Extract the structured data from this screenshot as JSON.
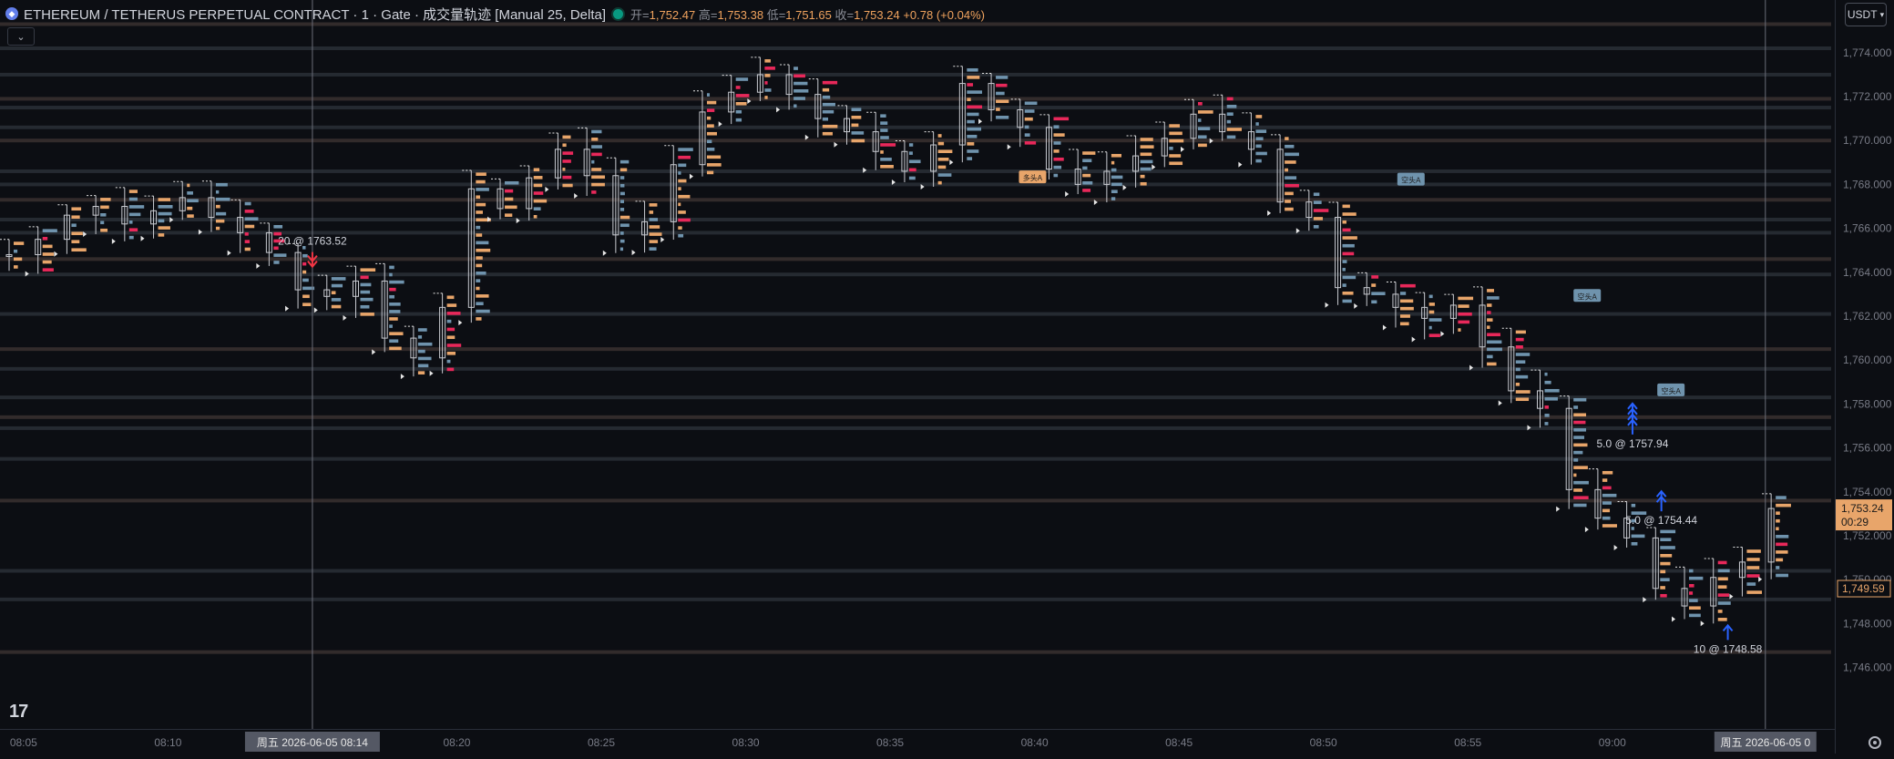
{
  "header": {
    "symbol": "ETHEREUM / TETHERUS PERPETUAL CONTRACT · 1 · Gate · 成交量轨迹 [Manual 25, Delta]",
    "open_label": "开=",
    "open": "1,752.47",
    "high_label": "高=",
    "high": "1,753.38",
    "low_label": "低=",
    "low": "1,751.65",
    "close_label": "收=",
    "close": "1,753.24",
    "change": "+0.78 (+0.04%)"
  },
  "currency_button": "USDT",
  "crosshair": {
    "left_date_label": "周五 2026-06-05   08:14",
    "right_date_label": "周五 2026-06-05   0"
  },
  "price_tags": {
    "last_price": "1,753.24",
    "countdown": "00:29",
    "marker_price": "1,749.59"
  },
  "colors": {
    "background": "#0c0e13",
    "buy_bar": "#e8a56a",
    "sell_bar": "#6f93ad",
    "delta_highlight": "#e8285a",
    "level_line": "#2a2f37",
    "arrow_blue": "#2962ff",
    "arrow_red": "#f23645"
  },
  "chart_data": {
    "type": "line",
    "title": "",
    "xlabel": "",
    "ylabel": "",
    "x_ticks": [
      "08:05",
      "08:10",
      "08:20",
      "08:25",
      "08:30",
      "08:35",
      "08:40",
      "08:45",
      "08:50",
      "08:55",
      "09:00"
    ],
    "y_ticks": [
      1746,
      1748,
      1750,
      1752,
      1754,
      1756,
      1758,
      1760,
      1762,
      1764,
      1766,
      1768,
      1770,
      1772,
      1774
    ],
    "ylim": [
      1743.2,
      1776.4
    ],
    "x_minutes_range": [
      0,
      61.5
    ],
    "series": [
      {
        "values": [
          {
            "t": 0,
            "p": 1764.8
          },
          {
            "t": 1,
            "p": 1765.5
          },
          {
            "t": 2,
            "p": 1766.6
          },
          {
            "t": 3,
            "p": 1767.0
          },
          {
            "t": 4,
            "p": 1766.2
          },
          {
            "t": 5,
            "p": 1766.8
          },
          {
            "t": 6,
            "p": 1767.4
          },
          {
            "t": 7,
            "p": 1766.5
          },
          {
            "t": 8,
            "p": 1765.8
          },
          {
            "t": 9,
            "p": 1764.9
          },
          {
            "t": 10,
            "p": 1763.2
          },
          {
            "t": 11,
            "p": 1762.9
          },
          {
            "t": 12,
            "p": 1763.6
          },
          {
            "t": 13,
            "p": 1761.0
          },
          {
            "t": 14,
            "p": 1760.1
          },
          {
            "t": 15,
            "p": 1762.4
          },
          {
            "t": 16,
            "p": 1767.8
          },
          {
            "t": 17,
            "p": 1766.9
          },
          {
            "t": 18,
            "p": 1768.3
          },
          {
            "t": 19,
            "p": 1769.6
          },
          {
            "t": 20,
            "p": 1768.4
          },
          {
            "t": 21,
            "p": 1765.7
          },
          {
            "t": 22,
            "p": 1766.3
          },
          {
            "t": 23,
            "p": 1768.9
          },
          {
            "t": 24,
            "p": 1771.3
          },
          {
            "t": 25,
            "p": 1772.2
          },
          {
            "t": 26,
            "p": 1773.0
          },
          {
            "t": 27,
            "p": 1772.1
          },
          {
            "t": 28,
            "p": 1771.0
          },
          {
            "t": 29,
            "p": 1770.4
          },
          {
            "t": 30,
            "p": 1769.5
          },
          {
            "t": 31,
            "p": 1768.6
          },
          {
            "t": 32,
            "p": 1769.8
          },
          {
            "t": 33,
            "p": 1772.6
          },
          {
            "t": 34,
            "p": 1771.4
          },
          {
            "t": 35,
            "p": 1770.6
          },
          {
            "t": 36,
            "p": 1768.7
          },
          {
            "t": 37,
            "p": 1768.0
          },
          {
            "t": 38,
            "p": 1768.6
          },
          {
            "t": 39,
            "p": 1769.3
          },
          {
            "t": 40,
            "p": 1770.1
          },
          {
            "t": 41,
            "p": 1771.2
          },
          {
            "t": 42,
            "p": 1770.4
          },
          {
            "t": 43,
            "p": 1769.6
          },
          {
            "t": 44,
            "p": 1767.2
          },
          {
            "t": 45,
            "p": 1766.5
          },
          {
            "t": 46,
            "p": 1763.3
          },
          {
            "t": 47,
            "p": 1763.0
          },
          {
            "t": 48,
            "p": 1762.4
          },
          {
            "t": 49,
            "p": 1761.9
          },
          {
            "t": 50,
            "p": 1762.5
          },
          {
            "t": 51,
            "p": 1760.6
          },
          {
            "t": 52,
            "p": 1758.6
          },
          {
            "t": 53,
            "p": 1757.8
          },
          {
            "t": 54,
            "p": 1754.1
          },
          {
            "t": 55,
            "p": 1752.8
          },
          {
            "t": 56,
            "p": 1751.9
          },
          {
            "t": 57,
            "p": 1749.6
          },
          {
            "t": 58,
            "p": 1748.8
          },
          {
            "t": 59,
            "p": 1750.1
          },
          {
            "t": 60,
            "p": 1750.8
          },
          {
            "t": 61,
            "p": 1753.24
          }
        ]
      }
    ],
    "horizontal_levels": [
      1775.3,
      1774.2,
      1773.0,
      1771.9,
      1771.5,
      1770.6,
      1770.0,
      1768.6,
      1768.0,
      1767.3,
      1766.4,
      1765.8,
      1764.6,
      1763.9,
      1762.1,
      1760.5,
      1759.6,
      1758.3,
      1757.4,
      1756.9,
      1755.5,
      1753.6,
      1750.4,
      1749.1,
      1746.7
    ],
    "trade_markers": [
      {
        "t": 10.5,
        "p": 1765.5,
        "label": "20 @ 1763.52",
        "direction": "sell"
      },
      {
        "t": 56.2,
        "p": 1757.94,
        "label": "5.0 @ 1757.94",
        "direction": "buy",
        "stack": 4
      },
      {
        "t": 57.2,
        "p": 1754.44,
        "label": "5.0 @ 1754.44",
        "direction": "buy",
        "stack": 2
      },
      {
        "t": 59.5,
        "p": 1748.58,
        "label": "10 @ 1748.58",
        "direction": "buy",
        "stack": 1
      }
    ],
    "annotations": [
      {
        "t": 35.4,
        "p": 1768.3,
        "label": "多头A",
        "color": "#e8a56a",
        "below": true
      },
      {
        "t": 48.5,
        "p": 1768.2,
        "label": "空头A",
        "color": "#6f93ad",
        "below": false
      },
      {
        "t": 54.6,
        "p": 1762.9,
        "label": "空头A",
        "color": "#6f93ad",
        "below": false
      },
      {
        "t": 57.5,
        "p": 1758.6,
        "label": "空头A",
        "color": "#6f93ad",
        "below": false
      }
    ],
    "crosshair_times": [
      10.5,
      60.8
    ],
    "grid": false
  }
}
